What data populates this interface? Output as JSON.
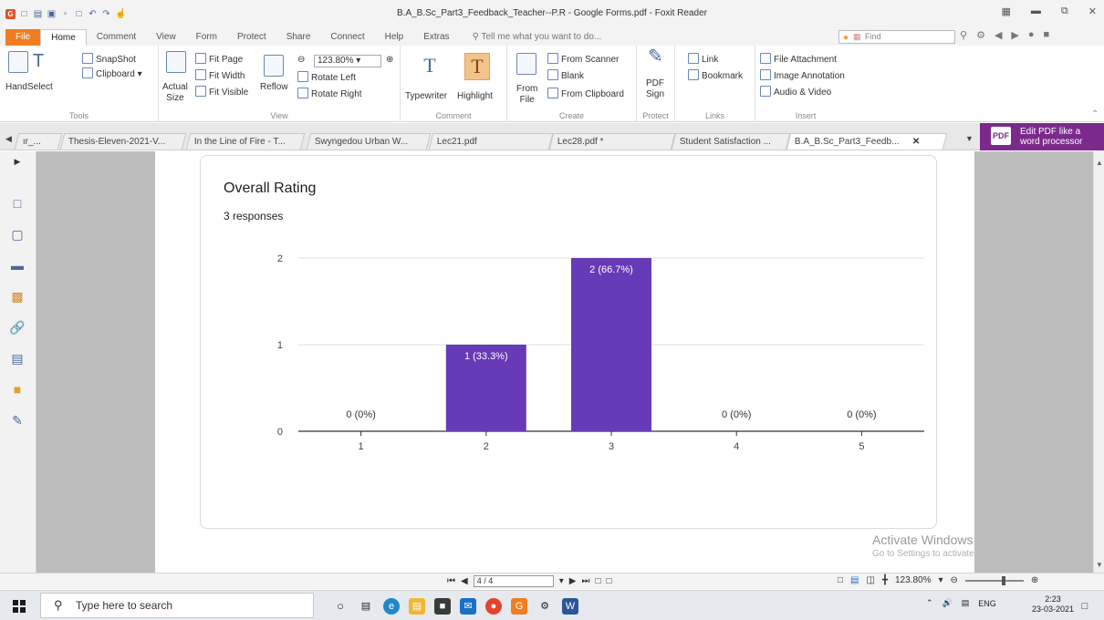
{
  "window": {
    "title": "B.A_B.Sc_Part3_Feedback_Teacher--P.R - Google Forms.pdf - Foxit Reader"
  },
  "ribbon_tabs": [
    "File",
    "Home",
    "Comment",
    "View",
    "Form",
    "Protect",
    "Share",
    "Connect",
    "Help",
    "Extras"
  ],
  "tell_me": "Tell me what you want to do...",
  "find_placeholder": "Find",
  "ribbon": {
    "tools": {
      "hand": "Hand",
      "select": "Select",
      "snapshot": "SnapShot",
      "clipboard": "Clipboard",
      "label": "Tools"
    },
    "view": {
      "actual_size_1": "Actual",
      "actual_size_2": "Size",
      "fit_page": "Fit Page",
      "fit_width": "Fit Width",
      "fit_visible": "Fit Visible",
      "reflow": "Reflow",
      "zoom": "123.80%",
      "rotate_left": "Rotate Left",
      "rotate_right": "Rotate Right",
      "label": "View"
    },
    "comment": {
      "typewriter": "Typewriter",
      "highlight": "Highlight",
      "label": "Comment"
    },
    "create": {
      "from_file_1": "From",
      "from_file_2": "File",
      "from_scanner": "From Scanner",
      "blank": "Blank",
      "from_clipboard": "From Clipboard",
      "label": "Create"
    },
    "protect": {
      "pdf_sign_1": "PDF",
      "pdf_sign_2": "Sign",
      "label": "Protect"
    },
    "links": {
      "link": "Link",
      "bookmark": "Bookmark",
      "label": "Links"
    },
    "insert": {
      "file_attachment": "File Attachment",
      "image_annotation": "Image Annotation",
      "audio_video": "Audio & Video",
      "label": "Insert"
    }
  },
  "doc_tabs": [
    "ır_...",
    "Thesis-Eleven-2021-V...",
    "In the Line of Fire - T...",
    "Swyngedou Urban W...",
    "Lec21.pdf",
    "Lec28.pdf *",
    "Student Satisfaction ...",
    "B.A_B.Sc_Part3_Feedb..."
  ],
  "promo": {
    "line1": "Edit PDF like a",
    "line2": "word processor"
  },
  "card": {
    "title": "Overall Rating",
    "subtitle": "3 responses"
  },
  "chart_data": {
    "type": "bar",
    "title": "Overall Rating",
    "categories": [
      "1",
      "2",
      "3",
      "4",
      "5"
    ],
    "values": [
      0,
      1,
      2,
      0,
      0
    ],
    "data_labels": [
      "0 (0%)",
      "1 (33.3%)",
      "2 (66.7%)",
      "0 (0%)",
      "0 (0%)"
    ],
    "yticks": [
      "0",
      "1",
      "2"
    ],
    "ylim": [
      0,
      2
    ],
    "grid": true,
    "bar_color": "#673ab7"
  },
  "watermark": {
    "line1": "Activate Windows",
    "line2": "Go to Settings to activate Windows."
  },
  "status": {
    "page": "4 / 4",
    "zoom": "123.80%"
  },
  "taskbar": {
    "search_placeholder": "Type here to search",
    "tray_lang": "ENG",
    "time": "2:23",
    "date": "23-03-2021"
  }
}
